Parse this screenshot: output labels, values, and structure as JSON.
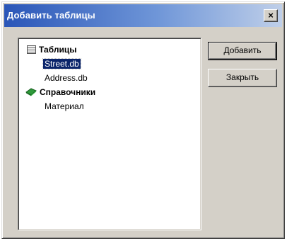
{
  "window": {
    "title": "Добавить таблицы",
    "close_label": "×"
  },
  "tree": {
    "groups": [
      {
        "label": "Таблицы",
        "icon": "table-icon",
        "items": [
          {
            "label": "Street.db",
            "selected": true
          },
          {
            "label": "Address.db",
            "selected": false
          }
        ]
      },
      {
        "label": "Справочники",
        "icon": "book-icon",
        "items": [
          {
            "label": "Материал",
            "selected": false
          }
        ]
      }
    ]
  },
  "buttons": {
    "add_label": "Добавить",
    "close_label": "Закрыть"
  },
  "colors": {
    "titlebar_start": "#2a56b8",
    "titlebar_end": "#bfcfe9",
    "selection": "#0a246a",
    "face": "#d4d0c8"
  }
}
